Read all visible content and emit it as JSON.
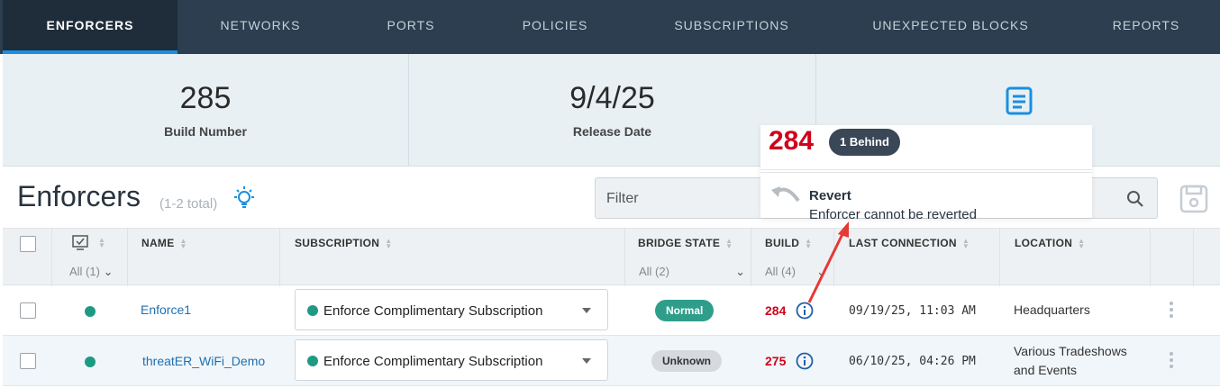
{
  "nav": {
    "tabs": [
      {
        "label": "ENFORCERS",
        "active": true
      },
      {
        "label": "NETWORKS"
      },
      {
        "label": "PORTS"
      },
      {
        "label": "POLICIES"
      },
      {
        "label": "SUBSCRIPTIONS"
      },
      {
        "label": "UNEXPECTED BLOCKS"
      },
      {
        "label": "REPORTS"
      }
    ]
  },
  "stats": {
    "build": {
      "value": "285",
      "label": "Build Number"
    },
    "release": {
      "value": "9/4/25",
      "label": "Release Date"
    },
    "notes_icon": "document-icon"
  },
  "page": {
    "title": "Enforcers",
    "count": "(1-2 total)",
    "hint_icon": "lightbulb-icon"
  },
  "filter": {
    "placeholder": "Filter"
  },
  "table": {
    "headers": {
      "name": "NAME",
      "subscription": "SUBSCRIPTION",
      "bridge_state": "BRIDGE STATE",
      "build": "BUILD",
      "last_connection": "LAST CONNECTION",
      "location": "LOCATION"
    },
    "filters": {
      "status": "All (1)",
      "bridge_state": "All (2)",
      "build": "All (4)"
    },
    "rows": [
      {
        "name": "Enforce1",
        "subscription": "Enforce Complimentary Subscription",
        "bridge_state": "Normal",
        "build": "284",
        "last_connection": "09/19/25, 11:03 AM",
        "location": "Headquarters",
        "location_line2": ""
      },
      {
        "name": "threatER_WiFi_Demo",
        "subscription": "Enforce Complimentary Subscription",
        "bridge_state": "Unknown",
        "build": "275",
        "last_connection": "06/10/25, 04:26 PM",
        "location": "Various Tradeshows",
        "location_line2": "and Events"
      }
    ]
  },
  "popover": {
    "build": "284",
    "badge": "1 Behind",
    "action_title": "Revert",
    "action_subtitle": "Enforcer cannot be reverted"
  },
  "colors": {
    "nav_bg": "#2c3e50",
    "accent": "#1a8fe0",
    "status_green": "#1f9a82",
    "build_red": "#d0021b"
  }
}
